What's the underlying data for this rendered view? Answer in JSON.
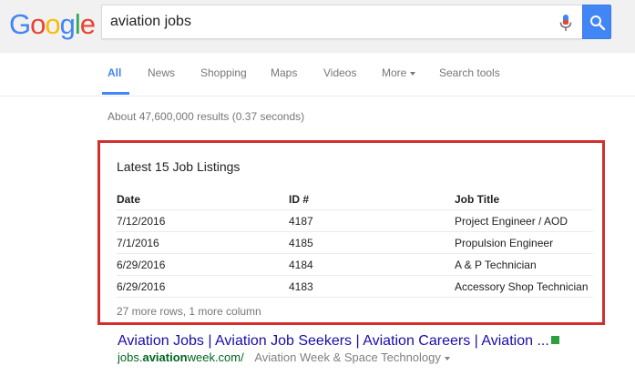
{
  "logo": {
    "letters": [
      "G",
      "o",
      "o",
      "g",
      "l",
      "e"
    ],
    "colors": [
      "#4285f4",
      "#ea4335",
      "#fbbc05",
      "#4285f4",
      "#34a853",
      "#ea4335"
    ]
  },
  "search": {
    "query": "aviation jobs",
    "button_color": "#4285f4"
  },
  "tabs": [
    {
      "label": "All",
      "active": true
    },
    {
      "label": "News"
    },
    {
      "label": "Shopping"
    },
    {
      "label": "Maps"
    },
    {
      "label": "Videos"
    },
    {
      "label": "More"
    },
    {
      "label": "Search tools"
    }
  ],
  "results_stats": "About 47,600,000 results (0.37 seconds)",
  "job_card": {
    "title": "Latest 15 Job Listings",
    "columns": [
      "Date",
      "ID #",
      "Job Title"
    ],
    "rows": [
      [
        "7/12/2016",
        "4187",
        "Project Engineer / AOD"
      ],
      [
        "7/1/2016",
        "4185",
        "Propulsion Engineer"
      ],
      [
        "6/29/2016",
        "4184",
        "A & P Technician"
      ],
      [
        "6/29/2016",
        "4183",
        "Accessory Shop Technician"
      ]
    ],
    "more_rows": "27 more rows, 1 more column",
    "highlight_color": "#d32f2f"
  },
  "result": {
    "title": "Aviation Jobs | Aviation Job Seekers | Aviation Careers | Aviation ...",
    "url_prefix": "jobs.",
    "url_bold": "aviation",
    "url_suffix": "week.com/",
    "site_name": "Aviation Week & Space Technology"
  }
}
